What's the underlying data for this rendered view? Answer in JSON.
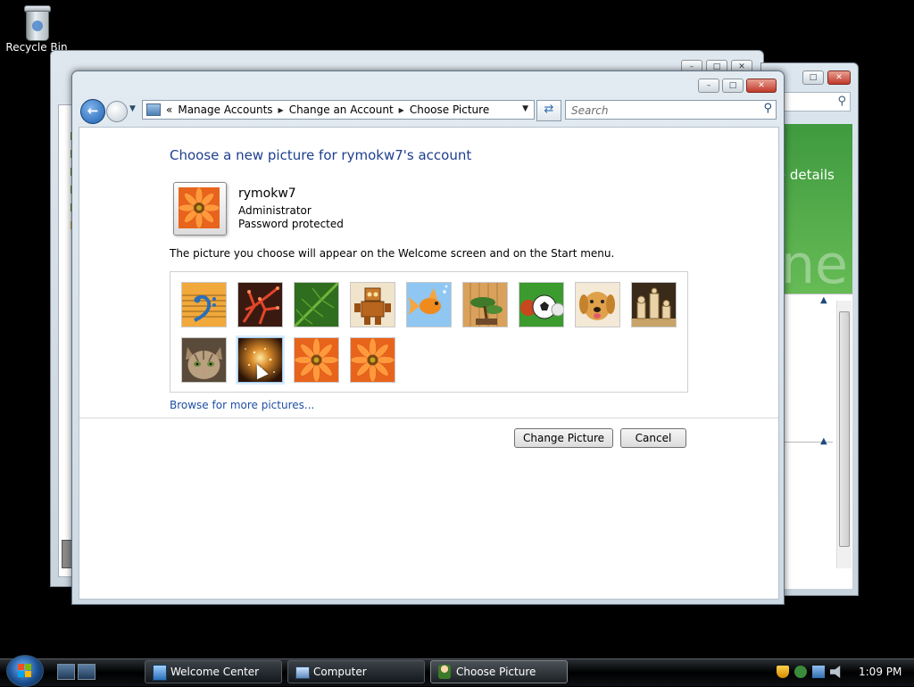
{
  "desktop": {
    "recycle_bin_label": "Recycle Bin"
  },
  "background_window_right": {
    "partial_text": "re details",
    "partial_large_text": "ne"
  },
  "window": {
    "breadcrumbs": [
      "Manage Accounts",
      "Change an Account",
      "Choose Picture"
    ],
    "search_placeholder": "Search",
    "heading": "Choose a new picture for rymokw7's account",
    "account": {
      "name": "rymokw7",
      "role": "Administrator",
      "password_status": "Password protected"
    },
    "description": "The picture you choose will appear on the Welcome screen and on the Start menu.",
    "pictures": [
      {
        "subject": "bass-clef",
        "selected": false
      },
      {
        "subject": "red-coral",
        "selected": false
      },
      {
        "subject": "green-leaf",
        "selected": false
      },
      {
        "subject": "toy-robot",
        "selected": false
      },
      {
        "subject": "goldfish",
        "selected": false
      },
      {
        "subject": "bonsai",
        "selected": false
      },
      {
        "subject": "sports-balls",
        "selected": false
      },
      {
        "subject": "golden-retriever",
        "selected": false
      },
      {
        "subject": "chess-pieces",
        "selected": false
      },
      {
        "subject": "kitten",
        "selected": false
      },
      {
        "subject": "sparkles",
        "selected": true
      },
      {
        "subject": "orange-daisy",
        "selected": false
      },
      {
        "subject": "orange-daisy",
        "selected": false
      }
    ],
    "browse_link": "Browse for more pictures...",
    "buttons": {
      "change_picture": "Change Picture",
      "cancel": "Cancel"
    }
  },
  "taskbar": {
    "tasks": [
      {
        "label": "Welcome Center",
        "active": false
      },
      {
        "label": "Computer",
        "active": false
      },
      {
        "label": "Choose Picture",
        "active": true
      }
    ],
    "clock": "1:09 PM"
  },
  "icons": [
    "recycle-bin-icon",
    "back-arrow-icon",
    "forward-arrow-icon",
    "refresh-icon",
    "search-icon",
    "start-orb-icon",
    "show-desktop-icon",
    "switch-windows-icon"
  ]
}
